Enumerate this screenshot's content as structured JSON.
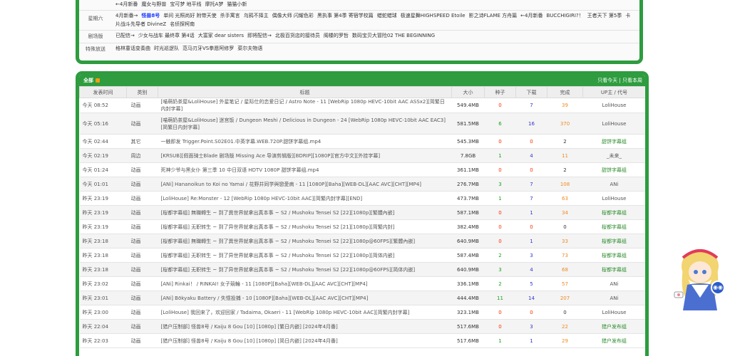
{
  "schedule": [
    {
      "day": "",
      "items": [
        "←4月新番",
        "魔女与野兽",
        "宝可梦 地平线",
        "摩托A梦",
        "猫猫小新"
      ]
    },
    {
      "day": "星期六",
      "items": [
        "4月新番→",
        "怪兽8号",
        "单间 光照尚好 附带天使",
        "杀手寓言",
        "乌鸦不择主",
        "偶像大师 闪耀色彩",
        "黑执事 第4季 寄宿学校篇",
        "蜡蛇蜡球",
        "极速星舞HIGHSPEED Etoile",
        "影之诗FLAME 方舟篇",
        "←4月新番",
        "BUCCHIGIRI?！",
        "王者天下 第5季",
        "卡片战斗先导者 DivineZ",
        "名侦探柯南"
      ]
    },
    {
      "day": "剧场版",
      "items": [
        "已配信→",
        "少女与战车 最终章 第4话",
        "大富家 dear sisters",
        "即将配信→",
        "北极百货店的接待员",
        "阁楼的罗哲",
        "数码宝贝大冒险02 THE BEGINNING"
      ]
    },
    {
      "day": "特殊放送",
      "items": [
        "格林童话变奏曲",
        "时光巡逻队",
        "范马刃牙VS拳愿阿修罗",
        "菜尔夫物语"
      ]
    }
  ],
  "schedule_highlight": "怪兽8号",
  "panel": {
    "title": "全部",
    "filter_label": "只看今天 | 只看本周"
  },
  "table": {
    "headers": [
      "发表时间",
      "类别",
      "标题",
      "大小",
      "种子",
      "下载",
      "完成",
      "UP主 / 代号"
    ],
    "rows": [
      {
        "date": "今天 08:52",
        "cat": "动画",
        "title": "[喵萌奶茶屋&LoliHouse] 外星笔记 / 星际仕的恋爱日记 / Astro Note - 11 [WebRip 1080p HEVC-10bit AAC ASSx2][简繁日内封字幕]",
        "size": "549.4MB",
        "seed": "0",
        "dl": "7",
        "done": "39",
        "up": "LoliHouse"
      },
      {
        "date": "今天 05:16",
        "cat": "动画",
        "title": "[喵萌奶茶屋&LoliHouse] 迷宫饭 / Dungeon Meshi / Delicious in Dungeon - 24 [WebRip 1080p HEVC-10bit AAC EAC3][简繁日内封字幕]",
        "size": "581.5MB",
        "seed": "6",
        "dl": "16",
        "done": "370",
        "up": "LoliHouse"
      },
      {
        "date": "今天 02:44",
        "cat": "其它",
        "title": "一触即发 Trigger.Point.S02E01.中英字幕.WEB.720P.甜饼字幕组.mp4",
        "size": "545.3MB",
        "seed": "0",
        "dl": "0",
        "done": "2",
        "up": "甜饼字幕组"
      },
      {
        "date": "今天 02:19",
        "cat": "周边",
        "title": "[KRSUB][假面骑士Blade 剧场版 Missing Ace 导演剪辑版][BDRIP][1080P][官方中文][外挂字幕]",
        "size": "7.8GB",
        "seed": "1",
        "dl": "4",
        "done": "11",
        "up": "_未来_"
      },
      {
        "date": "今天 01:24",
        "cat": "动画",
        "title": "死神少爷与黑女仆 第三季 10 中日双语 HDTV 1080P 甜饼字幕组.mp4",
        "size": "361.1MB",
        "seed": "0",
        "dl": "0",
        "done": "2",
        "up": "甜饼字幕组"
      },
      {
        "date": "今天 01:01",
        "cat": "动画",
        "title": "[ANi] Hananoikun to Koi no Yamai / 花野井同学與戀愛病 - 11 [1080P][Baha][WEB-DL][AAC AVC][CHT][MP4]",
        "size": "276.7MB",
        "seed": "3",
        "dl": "7",
        "done": "108",
        "up": "ANi"
      },
      {
        "date": "昨天 23:19",
        "cat": "动画",
        "title": "[LoliHouse] Re:Monster - 12 [WebRip 1080p HEVC-10bit AAC][简繁内封字幕][END]",
        "size": "473.7MB",
        "seed": "1",
        "dl": "7",
        "done": "63",
        "up": "LoliHouse"
      },
      {
        "date": "昨天 23:19",
        "cat": "动画",
        "title": "[桜都字幕组] 無職轉生 ~ 到了異世界就拿出真本事 ~ S2 / Mushoku Tensei S2 [22][1080p][繁體內嵌]",
        "size": "587.1MB",
        "seed": "0",
        "dl": "1",
        "done": "34",
        "up": "桜都字幕组"
      },
      {
        "date": "昨天 23:19",
        "cat": "动画",
        "title": "[桜都字幕组] 无职转生 ~ 到了异世界就拿出真本事 ~ S2 / Mushoku Tensei S2 [21][1080p][简繁内封]",
        "size": "382.4MB",
        "seed": "0",
        "dl": "0",
        "done": "0",
        "up": "桜都字幕组"
      },
      {
        "date": "昨天 23:18",
        "cat": "动画",
        "title": "[桜都字幕组] 無職轉生 ~ 到了異世界就拿出真本事 ~ S2 / Mushoku Tensei S2 [22][1080p@60FPS][繁體內嵌]",
        "size": "640.9MB",
        "seed": "0",
        "dl": "1",
        "done": "33",
        "up": "桜都字幕组"
      },
      {
        "date": "昨天 23:18",
        "cat": "动画",
        "title": "[桜都字幕组] 无职转生 ~ 到了异世界就拿出真本事 ~ S2 / Mushoku Tensei S2 [22][1080p][简体内嵌]",
        "size": "587.4MB",
        "seed": "2",
        "dl": "3",
        "done": "73",
        "up": "桜都字幕组"
      },
      {
        "date": "昨天 23:18",
        "cat": "动画",
        "title": "[桜都字幕组] 无职转生 ~ 到了异世界就拿出真本事 ~ S2 / Mushoku Tensei S2 [22][1080p@60FPS][简体内嵌]",
        "size": "640.9MB",
        "seed": "3",
        "dl": "4",
        "done": "68",
        "up": "桜都字幕组"
      },
      {
        "date": "昨天 23:02",
        "cat": "动画",
        "title": "[ANi] Rinkai！ / RINKAI! 女子競輪 - 11 [1080P][Baha][WEB-DL][AAC AVC][CHT][MP4]",
        "size": "336.1MB",
        "seed": "2",
        "dl": "5",
        "done": "57",
        "up": "ANi"
      },
      {
        "date": "昨天 23:01",
        "cat": "动画",
        "title": "[ANi] Bōkyaku Battery / 失憶投捕 - 10 [1080P][Baha][WEB-DL][AAC AVC][CHT][MP4]",
        "size": "444.4MB",
        "seed": "11",
        "dl": "14",
        "done": "207",
        "up": "ANi"
      },
      {
        "date": "昨天 23:00",
        "cat": "动画",
        "title": "[LoliHouse] 我回来了，欢迎回家 / Tadaima, Okaeri - 11 [WebRip 1080p HEVC-10bit AAC][简繁内封字幕]",
        "size": "323.1MB",
        "seed": "0",
        "dl": "0",
        "done": "0",
        "up": "LoliHouse"
      },
      {
        "date": "昨天 22:04",
        "cat": "动画",
        "title": "[猎户压制部] 怪兽8号 / Kaiju 8 Gou [10] [1080p] [繁日内嵌] [2024年4月番]",
        "size": "517.6MB",
        "seed": "0",
        "dl": "3",
        "done": "22",
        "up": "猎户发布组"
      },
      {
        "date": "昨天 22:03",
        "cat": "动画",
        "title": "[猎户压制部] 怪兽8号 / Kaiju 8 Gou [10] [1080p] [简日内嵌] [2024年4月番]",
        "size": "517.6MB",
        "seed": "1",
        "dl": "1",
        "done": "29",
        "up": "猎户发布组"
      }
    ]
  },
  "colors": {
    "panel_green": "#2e9c3f",
    "seed_red": "#ff2a00",
    "seed_green": "#1aa11a",
    "download_blue": "#3333cc",
    "done_orange": "#f08a24"
  },
  "mascot": {
    "chat_icon_label": "◉◉"
  }
}
